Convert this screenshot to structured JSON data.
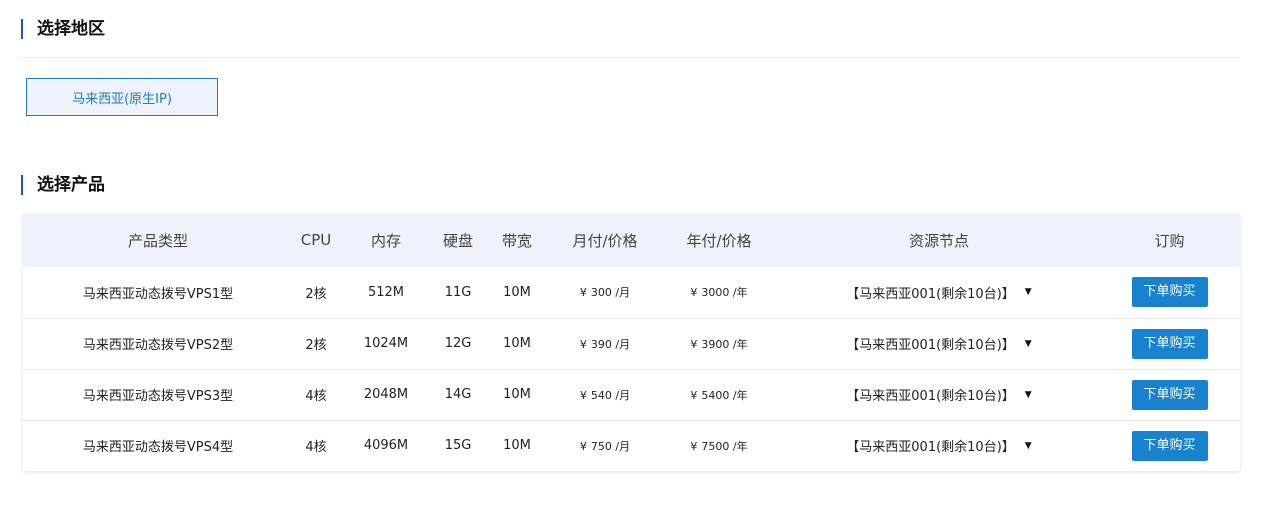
{
  "region_section": {
    "title": "选择地区",
    "selected_region": "马来西亚(原生IP)"
  },
  "product_section": {
    "title": "选择产品",
    "columns": [
      "产品类型",
      "CPU",
      "内存",
      "硬盘",
      "带宽",
      "月付/价格",
      "年付/价格",
      "资源节点",
      "订购"
    ],
    "currency_symbol": "¥",
    "rows": [
      {
        "name": "马来西亚动态拨号VPS1型",
        "cpu": "2核",
        "memory": "512M",
        "disk": "11G",
        "bandwidth": "10M",
        "monthly_price": "300",
        "monthly_unit": "/月",
        "yearly_price": "3000",
        "yearly_unit": "/年",
        "node": "【马来西亚001(剩余10台)】",
        "buy_label": "下单购买"
      },
      {
        "name": "马来西亚动态拨号VPS2型",
        "cpu": "2核",
        "memory": "1024M",
        "disk": "12G",
        "bandwidth": "10M",
        "monthly_price": "390",
        "monthly_unit": "/月",
        "yearly_price": "3900",
        "yearly_unit": "/年",
        "node": "【马来西亚001(剩余10台)】",
        "buy_label": "下单购买"
      },
      {
        "name": "马来西亚动态拨号VPS3型",
        "cpu": "4核",
        "memory": "2048M",
        "disk": "14G",
        "bandwidth": "10M",
        "monthly_price": "540",
        "monthly_unit": "/月",
        "yearly_price": "5400",
        "yearly_unit": "/年",
        "node": "【马来西亚001(剩余10台)】",
        "buy_label": "下单购买"
      },
      {
        "name": "马来西亚动态拨号VPS4型",
        "cpu": "4核",
        "memory": "4096M",
        "disk": "15G",
        "bandwidth": "10M",
        "monthly_price": "750",
        "monthly_unit": "/月",
        "yearly_price": "7500",
        "yearly_unit": "/年",
        "node": "【马来西亚001(剩余10台)】",
        "buy_label": "下单购买"
      }
    ]
  },
  "icons": {
    "node_dropdown": "caret-down-icon"
  },
  "colors": {
    "accent": "#1882cf",
    "region_border": "#1e7cc6",
    "header_bg": "#eef3fb",
    "title_bar": "#1e56a0"
  }
}
